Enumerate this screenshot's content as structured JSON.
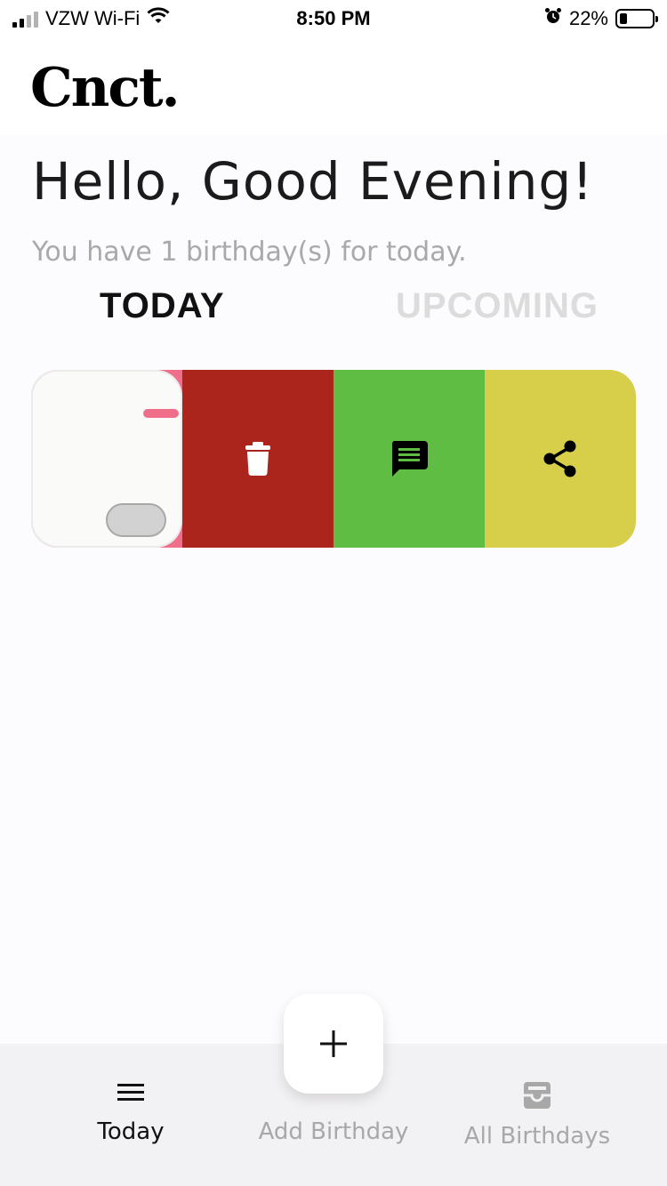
{
  "status_bar": {
    "carrier": "VZW Wi-Fi",
    "time": "8:50 PM",
    "battery": "22%",
    "battery_level": 0.22
  },
  "app": {
    "logo": "Cnct."
  },
  "greeting": "Hello, Good Evening!",
  "subtitle": "You have 1 birthday(s) for today.",
  "tabs": [
    {
      "label": "TODAY",
      "active": true
    },
    {
      "label": "UPCOMING",
      "active": false
    }
  ],
  "card_actions": [
    {
      "name": "delete",
      "icon": "trash-icon",
      "color": "#ab251d"
    },
    {
      "name": "message",
      "icon": "message-icon",
      "color": "#60bd43"
    },
    {
      "name": "share",
      "icon": "share-icon",
      "color": "#d7ce4a"
    }
  ],
  "bottom_nav": {
    "today_label": "Today",
    "add_label": "Add Birthday",
    "all_label": "All Birthdays",
    "fab_icon": "plus-icon"
  },
  "colors": {
    "accent_pink": "#ef6f8b",
    "inactive_text": "#a8a8a8"
  }
}
